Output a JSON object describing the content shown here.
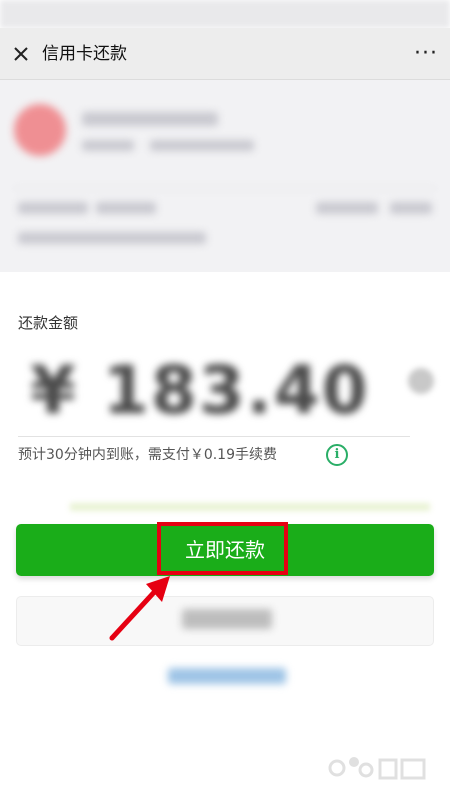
{
  "header": {
    "title": "信用卡还款",
    "more_label": "···"
  },
  "repay": {
    "amount_label": "还款金额",
    "amount_value": "¥ 183.40",
    "note": "预计30分钟内到账，需支付￥0.19手续费",
    "info_icon": "i",
    "pay_button_label": "立即还款"
  },
  "colors": {
    "accent": "#1aad19",
    "highlight": "#e60012",
    "info": "#2aae67"
  },
  "icons": [
    "close-icon",
    "more-icon",
    "info-icon",
    "clear-icon",
    "annotation-arrow"
  ]
}
